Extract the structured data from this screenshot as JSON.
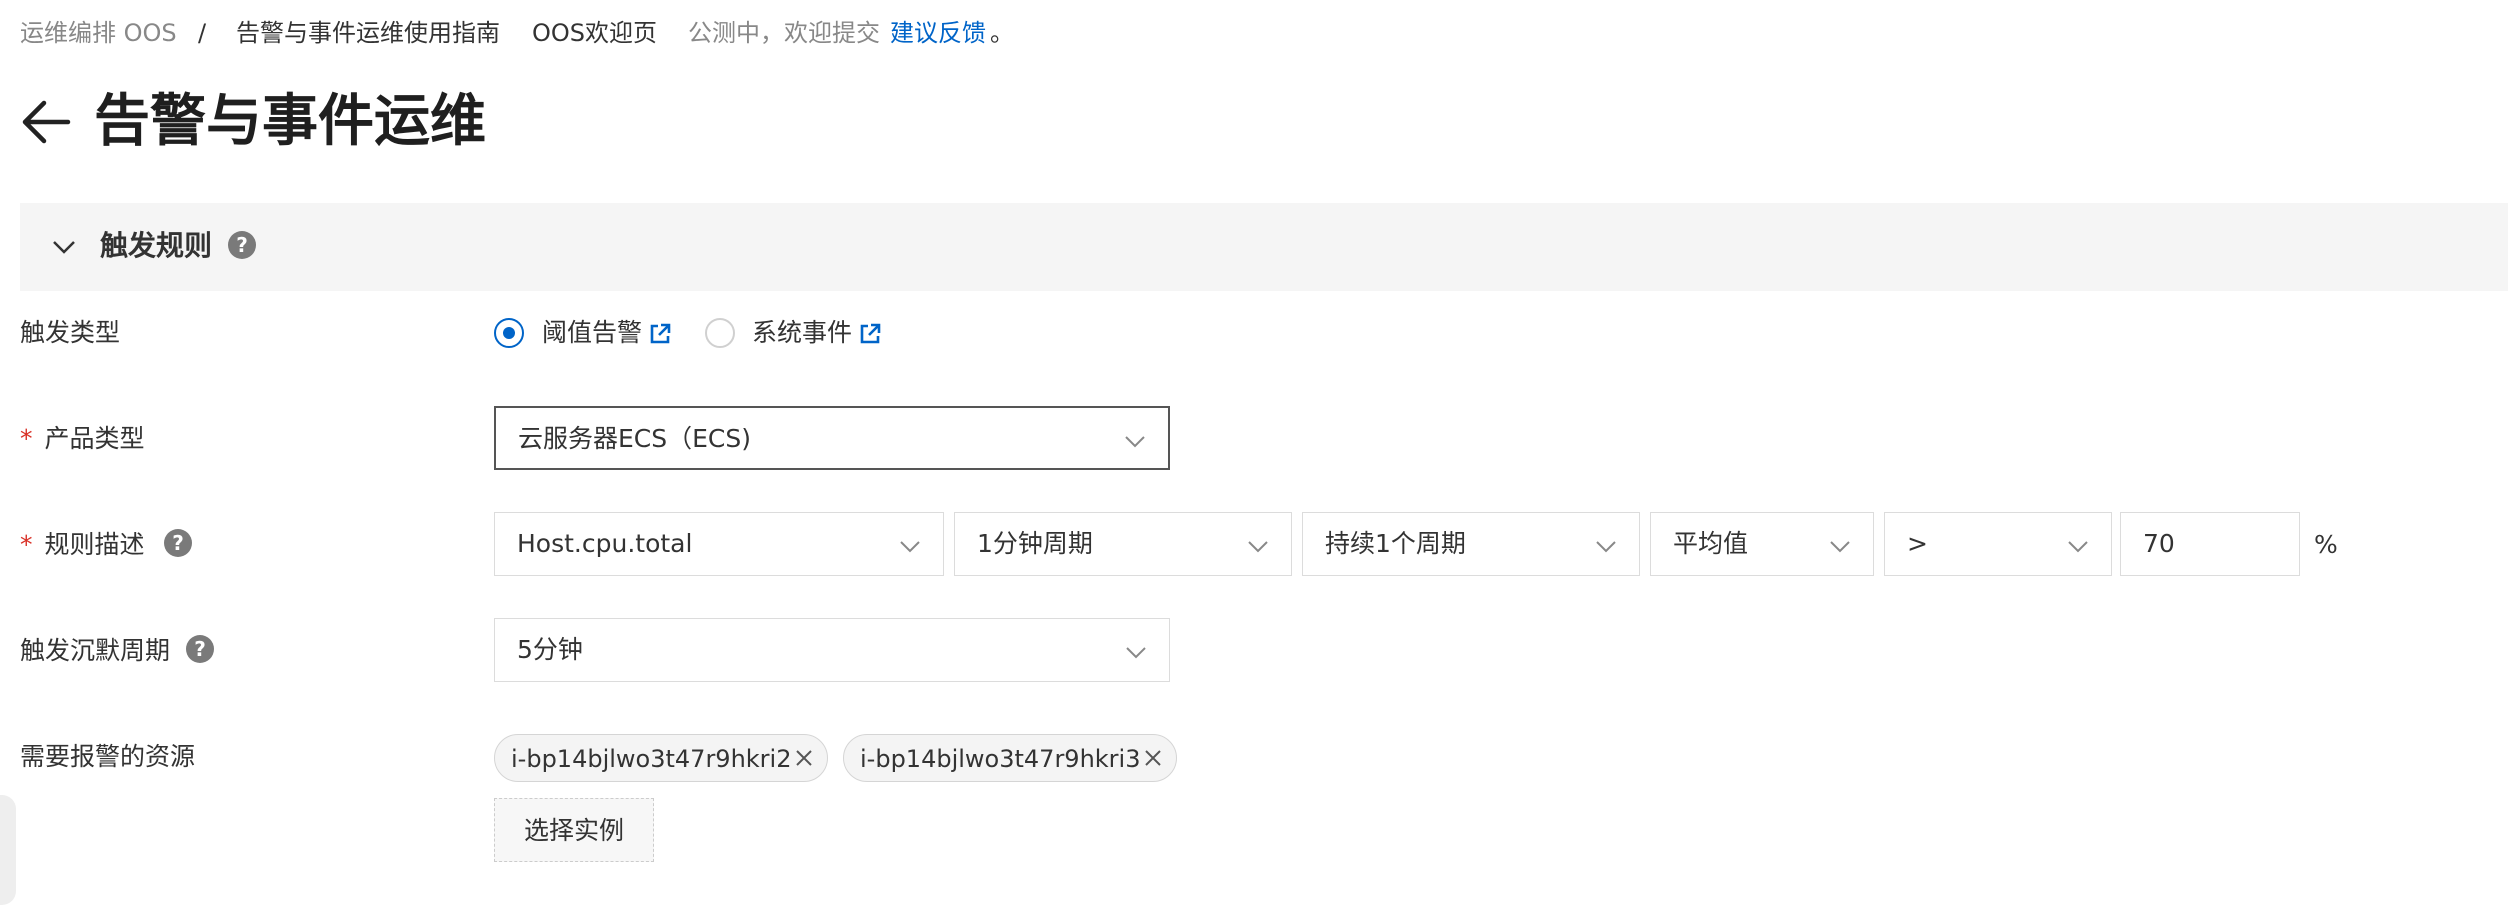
{
  "breadcrumb": {
    "root": "运维编排 OOS",
    "separator": "/",
    "guide": "告警与事件运维使用指南",
    "welcome": "OOS欢迎页",
    "beta_text": "公测中，欢迎提交",
    "feedback_link": "建议反馈",
    "period": "。"
  },
  "page": {
    "title": "告警与事件运维"
  },
  "section": {
    "title": "触发规则",
    "help": "?"
  },
  "form": {
    "trigger_type": {
      "label": "触发类型",
      "options": [
        {
          "label": "阈值告警",
          "selected": true
        },
        {
          "label": "系统事件",
          "selected": false
        }
      ]
    },
    "product_type": {
      "required_mark": "*",
      "label": "产品类型",
      "value": "云服务器ECS（ECS)"
    },
    "rule": {
      "required_mark": "*",
      "label": "规则描述",
      "help": "?",
      "metric": "Host.cpu.total",
      "period": "1分钟周期",
      "duration": "持续1个周期",
      "statistic": "平均值",
      "operator": ">",
      "threshold": "70",
      "unit": "%"
    },
    "silence": {
      "label": "触发沉默周期",
      "help": "?",
      "value": "5分钟"
    },
    "resources": {
      "label": "需要报警的资源",
      "tags": [
        "i-bp14bjlwo3t47r9hkri2",
        "i-bp14bjlwo3t47r9hkri3"
      ],
      "select_button": "选择实例"
    }
  },
  "colors": {
    "accent": "#0064c8",
    "required": "#d93026",
    "section_bg": "#f5f5f5"
  },
  "icons": [
    "back-arrow-icon",
    "chevron-down-icon",
    "help-icon",
    "external-link-icon",
    "close-icon"
  ]
}
